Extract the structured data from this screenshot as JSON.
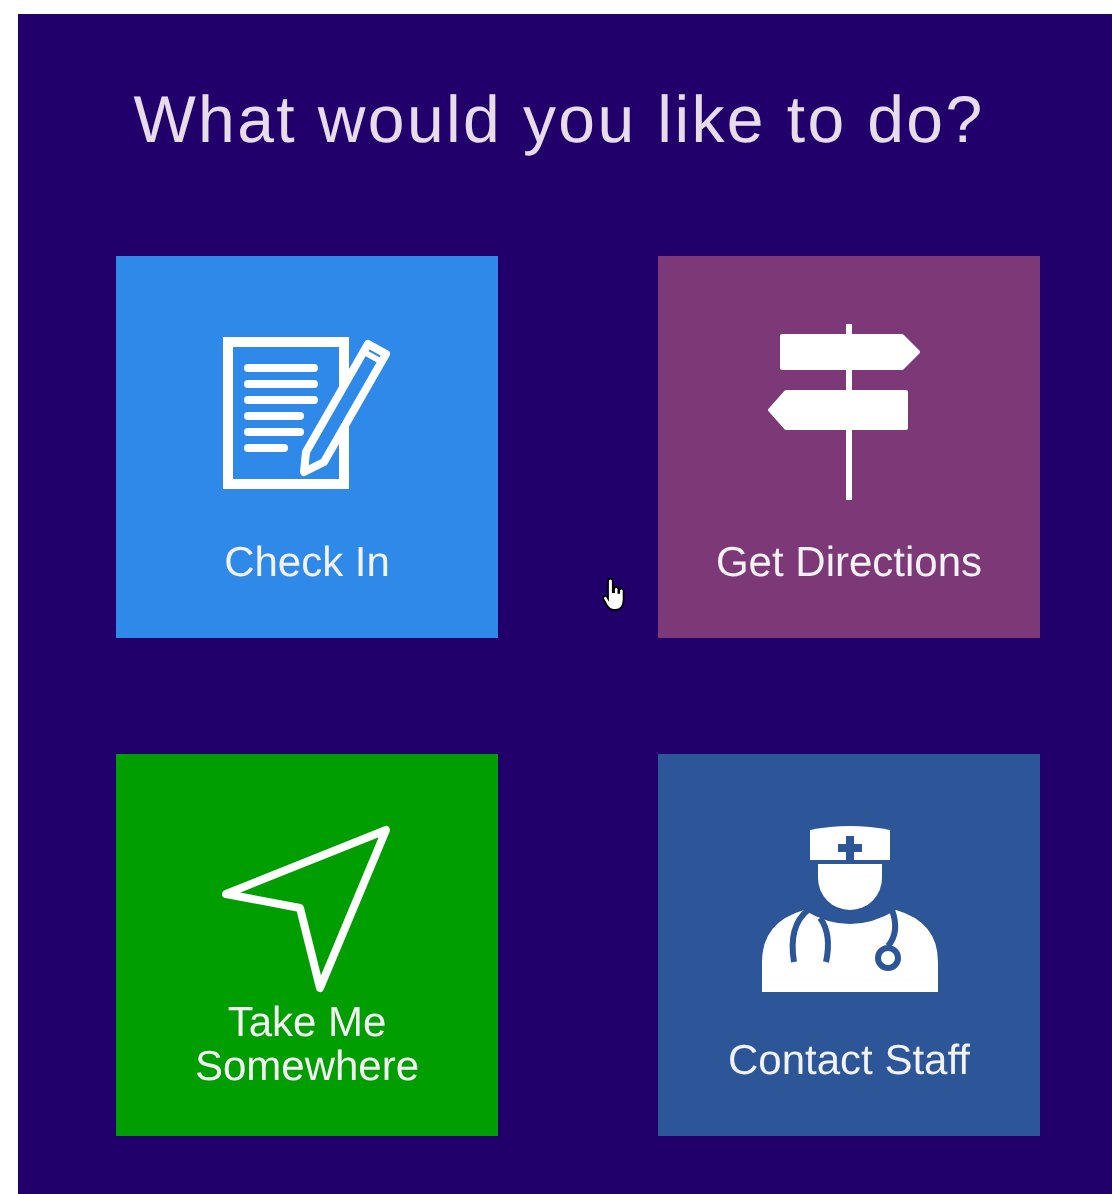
{
  "title": "What would you like to do?",
  "tiles": [
    {
      "label": "Check In",
      "color": "#2e89e8"
    },
    {
      "label": "Get Directions",
      "color": "#7d3878"
    },
    {
      "label": "Take Me Somewhere",
      "color": "#019e02"
    },
    {
      "label": "Contact Staff",
      "color": "#2c5697"
    }
  ]
}
